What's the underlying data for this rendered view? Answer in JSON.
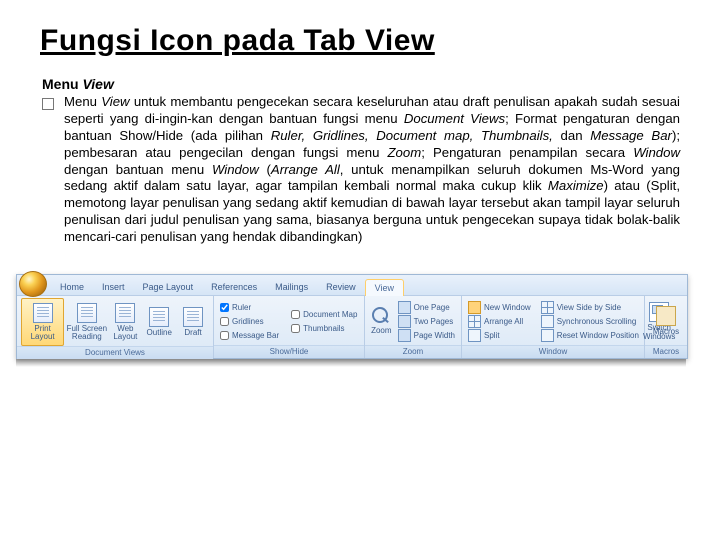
{
  "title": "Fungsi Icon pada Tab View",
  "subhead_prefix": "Menu ",
  "subhead_italic": "View",
  "body_segments": [
    {
      "t": "Menu "
    },
    {
      "t": "View",
      "i": true
    },
    {
      "t": " untuk membantu pengecekan secara keseluruhan atau draft penulisan apakah sudah sesuai seperti yang di-ingin-kan dengan bantuan fungsi menu "
    },
    {
      "t": "Document Views",
      "i": true
    },
    {
      "t": "; Format pengaturan dengan bantuan Show/Hide (ada pilihan "
    },
    {
      "t": "Ruler, Gridlines, Document map, Thumbnails,",
      "i": true
    },
    {
      "t": " dan "
    },
    {
      "t": "Message Bar",
      "i": true
    },
    {
      "t": "); pembesaran atau pengecilan dengan fungsi menu "
    },
    {
      "t": "Zoom",
      "i": true
    },
    {
      "t": "; Pengaturan penampilan secara "
    },
    {
      "t": "Window",
      "i": true
    },
    {
      "t": " dengan bantuan menu "
    },
    {
      "t": "Window",
      "i": true
    },
    {
      "t": " ("
    },
    {
      "t": "Arrange All",
      "i": true
    },
    {
      "t": ", untuk menampilkan seluruh dokumen Ms-Word yang sedang aktif dalam satu layar, agar tampilan kembali normal maka cukup klik "
    },
    {
      "t": "Maximize",
      "i": true
    },
    {
      "t": ") atau (Split, memotong layar penulisan yang sedang aktif kemudian di bawah layar tersebut akan tampil layar seluruh penulisan dari judul penulisan yang sama, biasanya berguna untuk pengecekan supaya tidak bolak-balik mencari-cari penulisan yang hendak dibandingkan)"
    }
  ],
  "ribbon": {
    "tabs": [
      "Home",
      "Insert",
      "Page Layout",
      "References",
      "Mailings",
      "Review",
      "View"
    ],
    "active_tab": "View",
    "groups": {
      "document_views": {
        "label": "Document Views",
        "buttons": [
          "Print Layout",
          "Full Screen Reading",
          "Web Layout",
          "Outline",
          "Draft"
        ]
      },
      "show_hide": {
        "label": "Show/Hide",
        "col1": [
          "Ruler",
          "Gridlines",
          "Message Bar"
        ],
        "col2": [
          "Document Map",
          "Thumbnails"
        ]
      },
      "zoom": {
        "label": "Zoom",
        "big": "Zoom",
        "items": [
          "One Page",
          "Two Pages",
          "Page Width"
        ]
      },
      "window": {
        "label": "Window",
        "col1": [
          "New Window",
          "Arrange All",
          "Split"
        ],
        "col2": [
          "View Side by Side",
          "Synchronous Scrolling",
          "Reset Window Position"
        ],
        "switch": "Switch Windows"
      },
      "macros": {
        "label": "Macros",
        "btn": "Macros"
      }
    }
  }
}
